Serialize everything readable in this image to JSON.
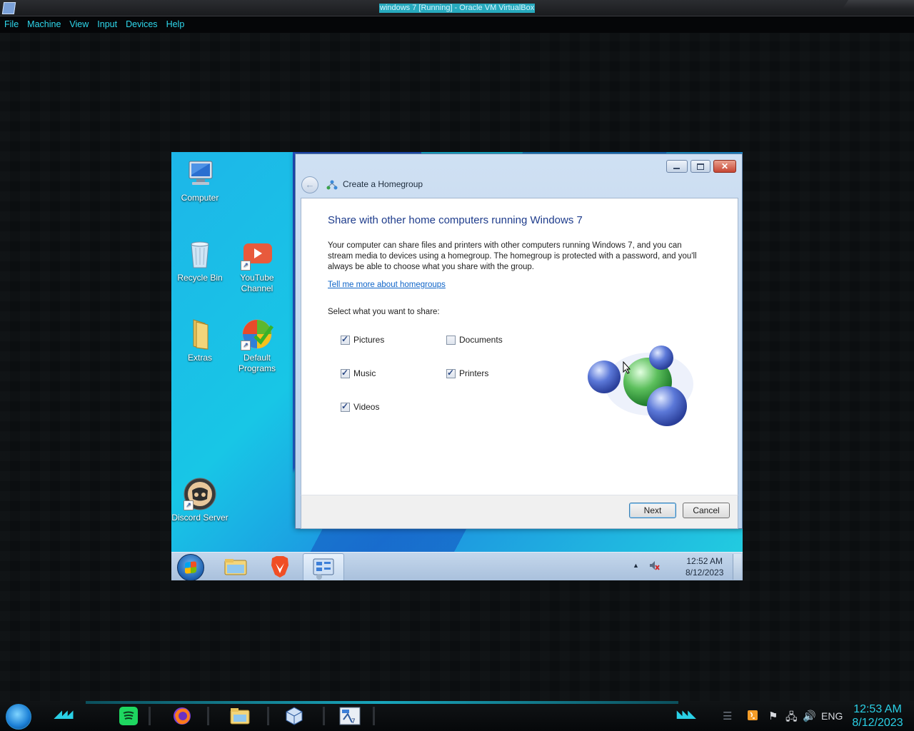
{
  "host": {
    "title": "windows 7 [Running] - Oracle VM VirtualBox",
    "menu": [
      "File",
      "Machine",
      "View",
      "Input",
      "Devices",
      "Help"
    ],
    "taskbar": {
      "tray_lang": "ENG",
      "time": "12:53 AM",
      "date": "8/12/2023",
      "apps": [
        "start-orb-icon",
        "spotify-icon",
        "firefox-icon",
        "file-explorer-icon",
        "virtualbox-icon",
        "windows7-vm-icon"
      ]
    }
  },
  "desktop": {
    "icons": [
      {
        "label_1": "Computer",
        "label_2": ""
      },
      {
        "label_1": "Recycle Bin",
        "label_2": ""
      },
      {
        "label_1": "YouTube",
        "label_2": "Channel"
      },
      {
        "label_1": "Extras",
        "label_2": ""
      },
      {
        "label_1": "Default",
        "label_2": "Programs"
      },
      {
        "label_1": "Discord Server",
        "label_2": ""
      }
    ]
  },
  "dialog": {
    "title": "Create a Homegroup",
    "heading": "Share with other home computers running Windows 7",
    "paragraph": "Your computer can share files and printers with other computers running Windows 7, and you can stream media to devices using a homegroup. The homegroup is protected with a password, and you'll always be able to choose what you share with the group.",
    "link": "Tell me more about homegroups",
    "prompt": "Select what you want to share:",
    "options": [
      {
        "label": "Pictures",
        "checked": true
      },
      {
        "label": "Documents",
        "checked": false
      },
      {
        "label": "Music",
        "checked": true
      },
      {
        "label": "Printers",
        "checked": true
      },
      {
        "label": "Videos",
        "checked": true
      }
    ],
    "buttons": {
      "next": "Next",
      "cancel": "Cancel"
    },
    "close_glyph": "✕"
  },
  "guest_taskbar": {
    "time": "12:52 AM",
    "date": "8/12/2023"
  },
  "colors": {
    "host_accent": "#2ad0e6",
    "dialog_heading": "#1e3c8c",
    "link": "#0e64c8"
  }
}
